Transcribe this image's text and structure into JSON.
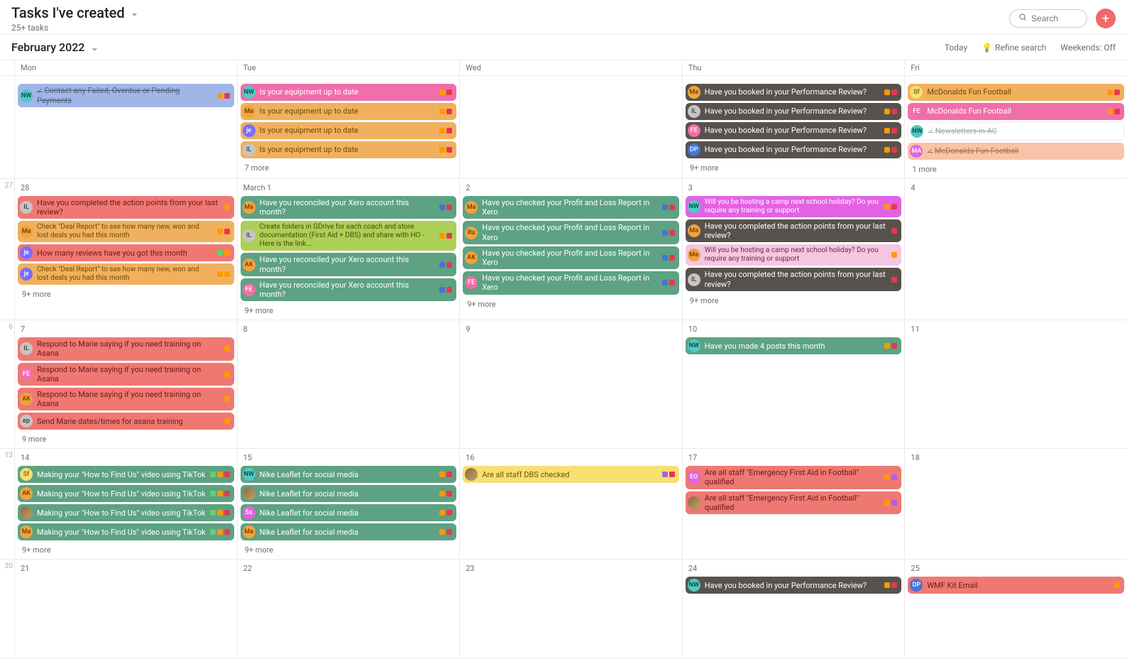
{
  "header": {
    "title": "Tasks I've created",
    "subtitle": "25+ tasks",
    "search_placeholder": "Search",
    "add_label": "+"
  },
  "subheader": {
    "month": "February 2022",
    "today": "Today",
    "refine": "Refine search",
    "weekends": "Weekends: Off"
  },
  "dayheads": [
    "Mon",
    "Tue",
    "Wed",
    "Thu",
    "Fri"
  ],
  "weeks": [
    {
      "num": "",
      "days": [
        {
          "label": "",
          "tasks": [
            {
              "bg": "bg-blue-soft",
              "av": "av-teal",
              "ini": "NW",
              "txt": "Contact any Failed, Overdue or Pending Payments",
              "done": true,
              "tags": [
                "t-orange",
                "t-red"
              ]
            }
          ],
          "more": ""
        },
        {
          "label": "",
          "tasks": [
            {
              "bg": "bg-pink",
              "av": "av-teal",
              "ini": "NW",
              "txt": "Is your equipment up to date",
              "tags": [
                "t-orange",
                "t-red"
              ]
            },
            {
              "bg": "bg-orange",
              "av": "av-orange",
              "ini": "Ma",
              "txt": "Is your equipment up to date",
              "tags": [
                "t-orange",
                "t-red"
              ]
            },
            {
              "bg": "bg-orange",
              "av": "av-purple",
              "ini": "je",
              "txt": "Is your equipment up to date",
              "tags": [
                "t-orange",
                "t-red"
              ]
            },
            {
              "bg": "bg-orange",
              "av": "av-gray",
              "ini": "IL",
              "txt": "Is your equipment up to date",
              "tags": [
                "t-orange",
                "t-red"
              ]
            }
          ],
          "more": "7 more"
        },
        {
          "label": "",
          "tasks": [],
          "more": ""
        },
        {
          "label": "",
          "tasks": [
            {
              "bg": "bg-gray-dark",
              "av": "av-orange",
              "ini": "Ma",
              "txt": "Have you booked in your Performance Review?",
              "tags": [
                "t-orange",
                "t-red"
              ]
            },
            {
              "bg": "bg-gray-dark",
              "av": "av-gray",
              "ini": "IL",
              "txt": "Have you booked in your Performance Review?",
              "tags": [
                "t-orange",
                "t-red"
              ]
            },
            {
              "bg": "bg-gray-dark",
              "av": "av-pink",
              "ini": "FE",
              "txt": "Have you booked in your Performance Review?",
              "tags": [
                "t-orange",
                "t-red"
              ]
            },
            {
              "bg": "bg-gray-dark",
              "av": "av-blue",
              "ini": "DP",
              "txt": "Have you booked in your Performance Review?",
              "tags": [
                "t-orange",
                "t-red"
              ]
            }
          ],
          "more": "9+ more"
        },
        {
          "label": "",
          "tasks": [
            {
              "bg": "bg-orange",
              "av": "av-yellow",
              "ini": "Sf",
              "txt": "McDonalds Fun Football",
              "tags": [
                "t-orange",
                "t-red"
              ]
            },
            {
              "bg": "bg-pink",
              "av": "av-pink",
              "ini": "FE",
              "txt": "McDonalds Fun Football",
              "tags": [
                "t-orange",
                "t-red"
              ]
            },
            {
              "bg": "bg-white",
              "av": "av-teal",
              "ini": "NW",
              "txt": "Newsletters in AC",
              "done": true,
              "tags": []
            },
            {
              "bg": "bg-peach",
              "av": "av-magenta",
              "ini": "MA",
              "txt": "McDonalds Fun Football",
              "done": true,
              "tags": []
            }
          ],
          "more": "1 more"
        }
      ]
    },
    {
      "num": "27",
      "days": [
        {
          "label": "28",
          "tasks": [
            {
              "bg": "bg-red",
              "av": "av-gray",
              "ini": "IL",
              "txt": "Have you completed the action points from your last review?",
              "tags": [
                "t-orange"
              ]
            },
            {
              "bg": "bg-orange",
              "av": "av-orange",
              "ini": "Ma",
              "txt": "Check \"Deal Report\" to see how many new, won and lost deals you had this month",
              "twoline": true,
              "tags": [
                "t-orange",
                "t-red"
              ]
            },
            {
              "bg": "bg-red",
              "av": "av-purple",
              "ini": "je",
              "txt": "How many reviews have you got this month",
              "tags": [
                "t-green",
                "t-orange"
              ]
            },
            {
              "bg": "bg-orange",
              "av": "av-purple",
              "ini": "je",
              "txt": "Check \"Deal Report\" to see how many new, won and lost deals you had this month",
              "twoline": true,
              "tags": [
                "t-orange",
                "t-orange"
              ]
            }
          ],
          "more": "9+ more"
        },
        {
          "label": "March 1",
          "tasks": [
            {
              "bg": "bg-green",
              "av": "av-orange",
              "ini": "Ma",
              "txt": "Have you reconciled your Xero account this month?",
              "tags": [
                "t-blue",
                "t-red"
              ]
            },
            {
              "bg": "bg-green-lt",
              "av": "av-gray",
              "ini": "IL",
              "txt": "Create folders in GDrive for each coach and store documentation (First Aid + DBS) and share with HO - Here is the link...",
              "twoline": true,
              "tags": [
                "t-orange",
                "t-red"
              ]
            },
            {
              "bg": "bg-green",
              "av": "av-orange",
              "ini": "AK",
              "txt": "Have you reconciled your Xero account this month?",
              "tags": [
                "t-blue",
                "t-red"
              ]
            },
            {
              "bg": "bg-green",
              "av": "av-pink",
              "ini": "FE",
              "txt": "Have you reconciled your Xero account this month?",
              "tags": [
                "t-blue",
                "t-red"
              ]
            }
          ],
          "more": "9+ more"
        },
        {
          "label": "2",
          "tasks": [
            {
              "bg": "bg-green",
              "av": "av-orange",
              "ini": "Ma",
              "txt": "Have you checked your Profit and Loss Report in Xero",
              "tags": [
                "t-blue",
                "t-red"
              ]
            },
            {
              "bg": "bg-green",
              "av": "av-orange",
              "ini": "Ru",
              "txt": "Have you checked your Profit and Loss Report in Xero",
              "tags": [
                "t-blue",
                "t-red"
              ]
            },
            {
              "bg": "bg-green",
              "av": "av-orange",
              "ini": "AK",
              "txt": "Have you checked your Profit and Loss Report in Xero",
              "tags": [
                "t-blue",
                "t-red"
              ]
            },
            {
              "bg": "bg-green",
              "av": "av-pink",
              "ini": "FE",
              "txt": "Have you checked your Profit and Loss Report in Xero",
              "tags": [
                "t-blue",
                "t-red"
              ]
            }
          ],
          "more": "9+ more"
        },
        {
          "label": "3",
          "tasks": [
            {
              "bg": "bg-magenta",
              "av": "av-teal",
              "ini": "NW",
              "txt": "Will you be hosting a camp next school holiday? Do you require any training or support",
              "twoline": true,
              "tags": [
                "t-orange",
                "t-red"
              ]
            },
            {
              "bg": "bg-gray-dark",
              "av": "av-orange",
              "ini": "Ma",
              "txt": "Have you completed the action points from your last review?",
              "tags": [
                "t-red"
              ]
            },
            {
              "bg": "bg-pink-lt",
              "av": "av-orange",
              "ini": "Ma",
              "txt": "Will you be hosting a camp next school holiday? Do you require any training or support",
              "twoline": true,
              "tags": [
                "t-orange"
              ]
            },
            {
              "bg": "bg-gray-dark",
              "av": "av-gray",
              "ini": "IL",
              "txt": "Have you completed the action points from your last review?",
              "tags": [
                "t-red"
              ]
            }
          ],
          "more": "9+ more"
        },
        {
          "label": "4",
          "tasks": [],
          "more": ""
        }
      ]
    },
    {
      "num": "6",
      "days": [
        {
          "label": "7",
          "tasks": [
            {
              "bg": "bg-red",
              "av": "av-gray",
              "ini": "IL",
              "txt": "Respond to Marie saying if you need training on Asana",
              "tags": [
                "t-orange"
              ]
            },
            {
              "bg": "bg-red",
              "av": "av-pink",
              "ini": "FE",
              "txt": "Respond to Marie saying if you need training on Asana",
              "tags": [
                "t-orange"
              ]
            },
            {
              "bg": "bg-red",
              "av": "av-orange",
              "ini": "AK",
              "txt": "Respond to Marie saying if you need training on Asana",
              "tags": [
                "t-orange"
              ]
            },
            {
              "bg": "bg-red",
              "av": "av-gray",
              "ini": "ep",
              "txt": "Send Marie dates/times for asana training",
              "tags": [
                "t-orange"
              ]
            }
          ],
          "more": "9 more"
        },
        {
          "label": "8",
          "tasks": [],
          "more": ""
        },
        {
          "label": "9",
          "tasks": [],
          "more": ""
        },
        {
          "label": "10",
          "tasks": [
            {
              "bg": "bg-green",
              "av": "av-teal",
              "ini": "NW",
              "txt": "Have you made 4 posts this month",
              "tags": [
                "t-orange",
                "t-red"
              ]
            }
          ],
          "more": ""
        },
        {
          "label": "11",
          "tasks": [],
          "more": ""
        }
      ]
    },
    {
      "num": "13",
      "days": [
        {
          "label": "14",
          "tasks": [
            {
              "bg": "bg-green",
              "av": "av-yellow",
              "ini": "Sf",
              "txt": "Making your \"How to Find Us\" video using TikTok",
              "tags": [
                "t-green",
                "t-orange",
                "t-red"
              ]
            },
            {
              "bg": "bg-green",
              "av": "av-orange",
              "ini": "AK",
              "txt": "Making your \"How to Find Us\" video using TikTok",
              "tags": [
                "t-green",
                "t-orange",
                "t-red"
              ]
            },
            {
              "bg": "bg-green",
              "av": "photo-av",
              "ini": "",
              "txt": "Making your \"How to Find Us\" video using TikTok",
              "tags": [
                "t-green",
                "t-orange",
                "t-red"
              ]
            },
            {
              "bg": "bg-green",
              "av": "av-orange",
              "ini": "Ma",
              "txt": "Making your \"How to Find Us\" video using TikTok",
              "tags": [
                "t-green",
                "t-orange",
                "t-red"
              ]
            }
          ],
          "more": "9+ more"
        },
        {
          "label": "15",
          "tasks": [
            {
              "bg": "bg-green",
              "av": "av-teal",
              "ini": "NW",
              "txt": "Nike Leaflet for social media",
              "tags": [
                "t-orange",
                "t-red"
              ]
            },
            {
              "bg": "bg-green",
              "av": "photo-av",
              "ini": "",
              "txt": "Nike Leaflet for social media",
              "tags": [
                "t-orange",
                "t-red"
              ]
            },
            {
              "bg": "bg-green",
              "av": "av-magenta",
              "ini": "Ss",
              "txt": "Nike Leaflet for social media",
              "tags": [
                "t-orange",
                "t-red"
              ]
            },
            {
              "bg": "bg-green",
              "av": "av-orange",
              "ini": "Ma",
              "txt": "Nike Leaflet for social media",
              "tags": [
                "t-orange",
                "t-red"
              ]
            }
          ],
          "more": "9+ more"
        },
        {
          "label": "16",
          "tasks": [
            {
              "bg": "bg-yellow",
              "av": "photo-av",
              "ini": "",
              "txt": "Are all staff DBS checked",
              "tags": [
                "t-purple",
                "t-red"
              ]
            }
          ],
          "more": ""
        },
        {
          "label": "17",
          "tasks": [
            {
              "bg": "bg-red",
              "av": "av-magenta",
              "ini": "EO",
              "txt": "Are all staff \"Emergency First Aid in Football\" qualified",
              "tags": [
                "t-orange",
                "t-purple"
              ]
            },
            {
              "bg": "bg-red",
              "av": "photo-av",
              "ini": "",
              "txt": "Are all staff \"Emergency First Aid in Football\" qualified",
              "tags": [
                "t-orange",
                "t-purple"
              ]
            }
          ],
          "more": ""
        },
        {
          "label": "18",
          "tasks": [],
          "more": ""
        }
      ]
    },
    {
      "num": "20",
      "days": [
        {
          "label": "21",
          "tasks": [],
          "more": ""
        },
        {
          "label": "22",
          "tasks": [],
          "more": ""
        },
        {
          "label": "23",
          "tasks": [],
          "more": ""
        },
        {
          "label": "24",
          "tasks": [
            {
              "bg": "bg-gray-dark",
              "av": "av-teal",
              "ini": "NW",
              "txt": "Have you booked in your Performance Review?",
              "tags": [
                "t-orange",
                "t-red"
              ]
            }
          ],
          "more": ""
        },
        {
          "label": "25",
          "tasks": [
            {
              "bg": "bg-red",
              "av": "av-blue",
              "ini": "DP",
              "txt": "WMF Kit Email",
              "tags": [
                "t-orange"
              ]
            }
          ],
          "more": ""
        }
      ]
    }
  ]
}
